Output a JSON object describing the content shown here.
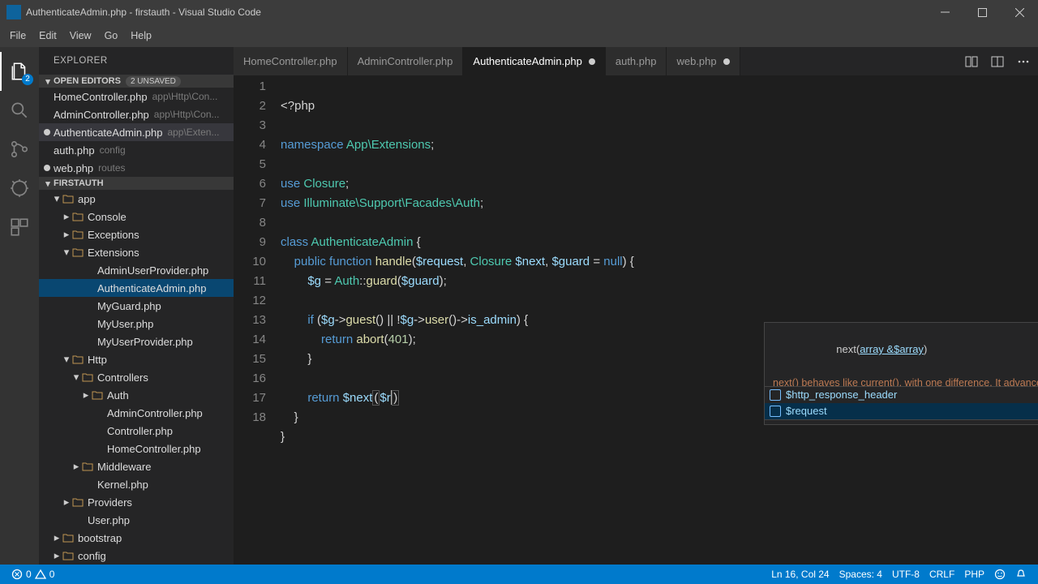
{
  "window": {
    "title": "AuthenticateAdmin.php - firstauth - Visual Studio Code"
  },
  "menu": [
    "File",
    "Edit",
    "View",
    "Go",
    "Help"
  ],
  "activity": {
    "explorer_badge": "2"
  },
  "sidebar": {
    "panel_title": "EXPLORER",
    "open_editors_label": "OPEN EDITORS",
    "unsaved_label": "2 UNSAVED",
    "open_editors": [
      {
        "name": "HomeController.php",
        "path": "app\\Http\\Con...",
        "dirty": false
      },
      {
        "name": "AdminController.php",
        "path": "app\\Http\\Con...",
        "dirty": false
      },
      {
        "name": "AuthenticateAdmin.php",
        "path": "app\\Exten...",
        "dirty": true
      },
      {
        "name": "auth.php",
        "path": "config",
        "dirty": false
      },
      {
        "name": "web.php",
        "path": "routes",
        "dirty": true
      }
    ],
    "project_label": "FIRSTAUTH",
    "tree": [
      {
        "depth": 0,
        "kind": "folder",
        "open": true,
        "label": "app"
      },
      {
        "depth": 1,
        "kind": "folder",
        "open": false,
        "label": "Console"
      },
      {
        "depth": 1,
        "kind": "folder",
        "open": false,
        "label": "Exceptions"
      },
      {
        "depth": 1,
        "kind": "folder",
        "open": true,
        "label": "Extensions"
      },
      {
        "depth": 2,
        "kind": "file",
        "label": "AdminUserProvider.php"
      },
      {
        "depth": 2,
        "kind": "file",
        "label": "AuthenticateAdmin.php",
        "selected": true
      },
      {
        "depth": 2,
        "kind": "file",
        "label": "MyGuard.php"
      },
      {
        "depth": 2,
        "kind": "file",
        "label": "MyUser.php"
      },
      {
        "depth": 2,
        "kind": "file",
        "label": "MyUserProvider.php"
      },
      {
        "depth": 1,
        "kind": "folder",
        "open": true,
        "label": "Http"
      },
      {
        "depth": 2,
        "kind": "folder",
        "open": true,
        "label": "Controllers"
      },
      {
        "depth": 3,
        "kind": "folder",
        "open": false,
        "label": "Auth"
      },
      {
        "depth": 3,
        "kind": "file",
        "label": "AdminController.php"
      },
      {
        "depth": 3,
        "kind": "file",
        "label": "Controller.php"
      },
      {
        "depth": 3,
        "kind": "file",
        "label": "HomeController.php"
      },
      {
        "depth": 2,
        "kind": "folder",
        "open": false,
        "label": "Middleware"
      },
      {
        "depth": 2,
        "kind": "file",
        "label": "Kernel.php"
      },
      {
        "depth": 1,
        "kind": "folder",
        "open": false,
        "label": "Providers"
      },
      {
        "depth": 1,
        "kind": "file",
        "label": "User.php"
      },
      {
        "depth": 0,
        "kind": "folder",
        "open": false,
        "label": "bootstrap"
      },
      {
        "depth": 0,
        "kind": "folder",
        "open": false,
        "label": "config"
      }
    ]
  },
  "tabs": [
    {
      "label": "HomeController.php",
      "dirty": false,
      "active": false
    },
    {
      "label": "AdminController.php",
      "dirty": false,
      "active": false
    },
    {
      "label": "AuthenticateAdmin.php",
      "dirty": true,
      "active": true
    },
    {
      "label": "auth.php",
      "dirty": false,
      "active": false
    },
    {
      "label": "web.php",
      "dirty": true,
      "active": false
    }
  ],
  "code": {
    "t_php": "<?php",
    "t_ns": "namespace",
    "t_nsv": "App\\Extensions",
    "sc": ";",
    "t_use": "use",
    "t_closure": "Closure",
    "t_ill": "Illuminate\\Support\\Facades\\Auth",
    "t_class": "class",
    "t_clsname": "AuthenticateAdmin",
    "ob": "{",
    "cb": "}",
    "t_public": "public",
    "t_function": "function",
    "t_handle": "handle",
    "op": "(",
    "cp": ")",
    "v_request": "$request",
    "comma": ", ",
    "t_closuret": "Closure ",
    "v_next": "$next",
    "v_guard": "$guard",
    "eq": " = ",
    "t_null": "null",
    "v_g": "$g",
    "t_auth": "Auth",
    "dcol": "::",
    "t_guard": "guard",
    "t_if": "if",
    "arrow": "->",
    "t_guest": "guest",
    "t_oror": " || ",
    "bang": "!",
    "t_user": "user",
    "t_isadmin": "is_admin",
    "t_return": "return",
    "t_abort": "abort",
    "n_401": "401",
    "t_nextcall": "$next",
    "v_r": "$r"
  },
  "lines": [
    "1",
    "2",
    "3",
    "4",
    "5",
    "6",
    "7",
    "8",
    "9",
    "10",
    "11",
    "12",
    "13",
    "14",
    "15",
    "16",
    "17",
    "18"
  ],
  "sighelp": {
    "sig_prefix": "next(",
    "sig_param": "array &$array",
    "sig_suffix": ")",
    "desc": "next() behaves like current(), with one difference. It advances the internal array pointer one place forward before returning the element value. That means it"
  },
  "suggest": [
    {
      "label": "$http_response_header",
      "selected": false
    },
    {
      "label": "$request",
      "selected": true
    }
  ],
  "status": {
    "errors": "0",
    "warnings": "0",
    "pos": "Ln 16, Col 24",
    "spaces": "Spaces: 4",
    "enc": "UTF-8",
    "eol": "CRLF",
    "lang": "PHP"
  }
}
